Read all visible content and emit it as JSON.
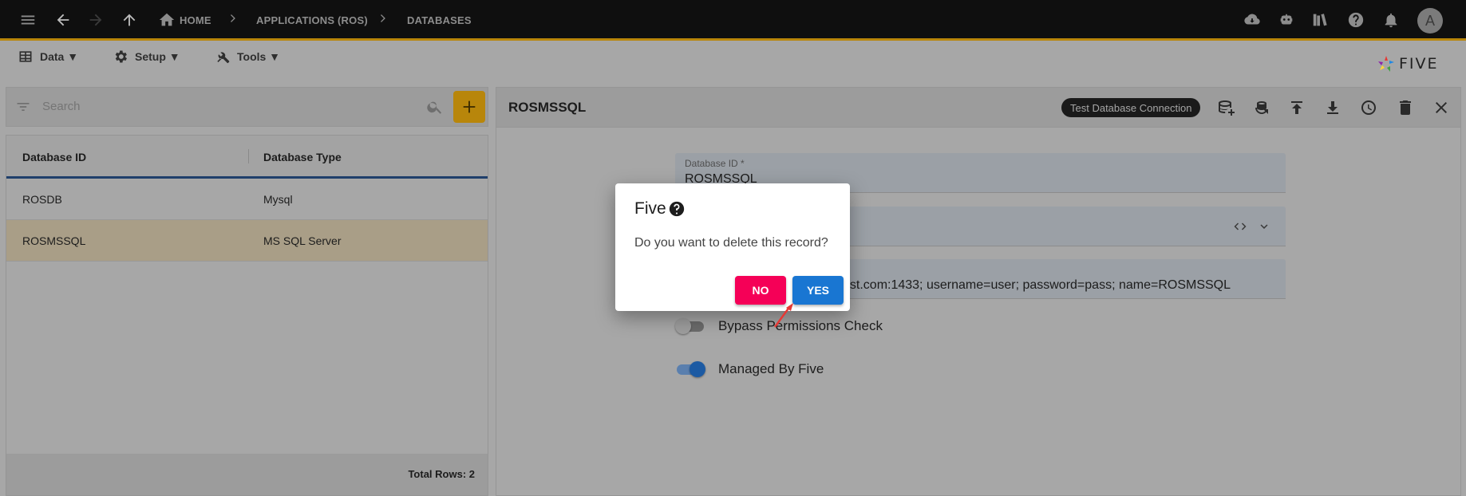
{
  "breadcrumb": {
    "home": "HOME",
    "app": "APPLICATIONS (ROS)",
    "current": "DATABASES"
  },
  "user": {
    "avatar_letter": "A"
  },
  "menubar": {
    "data": "Data ▼",
    "setup": "Setup ▼",
    "tools": "Tools ▼"
  },
  "brand": {
    "logo_text": "FIVE"
  },
  "list": {
    "search_placeholder": "Search",
    "columns": [
      "Database ID",
      "Database Type"
    ],
    "rows": [
      {
        "id": "ROSDB",
        "type": "Mysql",
        "selected": false
      },
      {
        "id": "ROSMSSQL",
        "type": "MS SQL Server",
        "selected": true
      }
    ],
    "total_rows": "Total Rows: 2"
  },
  "record": {
    "title": "ROSMSSQL",
    "test_button": "Test Database Connection",
    "database_id_label": "Database ID *",
    "database_id_value": "ROSMSSQL",
    "connection_value": "ost.com:1433; username=user; password=pass; name=ROSMSSQL",
    "bypass_label": "Bypass Permissions Check",
    "bypass_on": false,
    "managed_label": "Managed By Five",
    "managed_on": true
  },
  "dialog": {
    "title": "Five",
    "message": "Do you want to delete this record?",
    "no_label": "NO",
    "yes_label": "YES"
  },
  "colors": {
    "accent": "#b8860b",
    "no_button": "#f50057",
    "yes_button": "#1976d2",
    "toggle_on": "#1565c0"
  }
}
